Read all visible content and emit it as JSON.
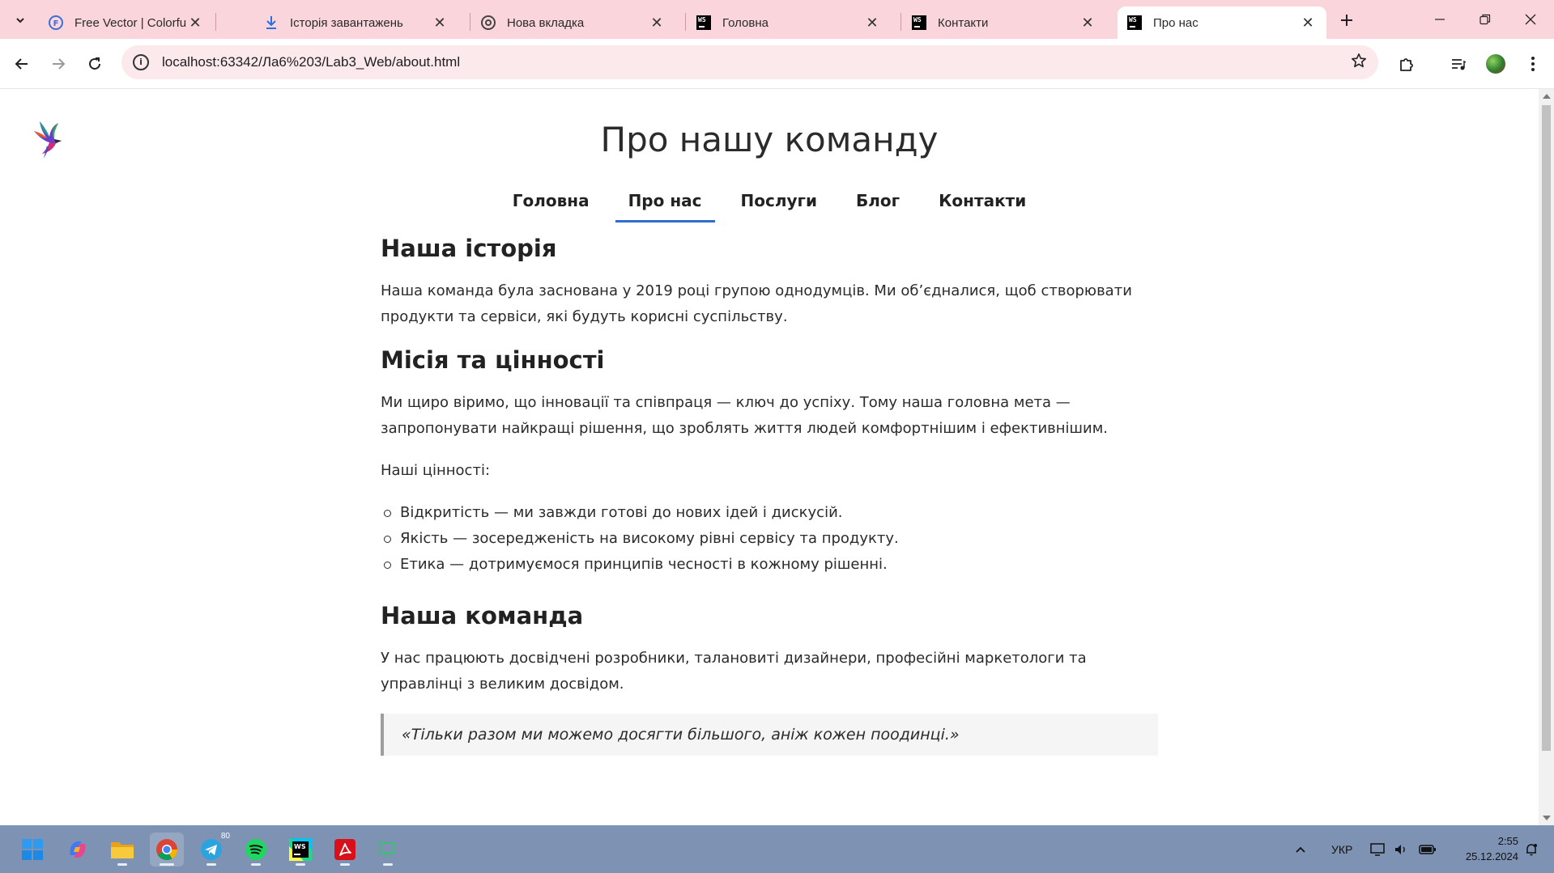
{
  "browser": {
    "tabs": [
      {
        "title": "Free Vector | Colorful bird il",
        "favicon": "freepik-icon",
        "active": false
      },
      {
        "title": "Історія завантажень",
        "favicon": "download-icon",
        "active": false
      },
      {
        "title": "Нова вкладка",
        "favicon": "chrome-icon",
        "active": false
      },
      {
        "title": "Головна",
        "favicon": "webstorm-icon",
        "active": false
      },
      {
        "title": "Контакти",
        "favicon": "webstorm-icon",
        "active": false
      },
      {
        "title": "Про нас",
        "favicon": "webstorm-icon",
        "active": true
      }
    ],
    "url": "localhost:63342/Ла6%203/Lab3_Web/about.html",
    "accent_color": "#fad6dc"
  },
  "page": {
    "title": "Про нашу команду",
    "nav": [
      {
        "label": "Головна",
        "active": false
      },
      {
        "label": "Про нас",
        "active": true
      },
      {
        "label": "Послуги",
        "active": false
      },
      {
        "label": "Блог",
        "active": false
      },
      {
        "label": "Контакти",
        "active": false
      }
    ],
    "sections": {
      "history": {
        "heading": "Наша історія",
        "text": "Наша команда була заснована у 2019 році групою однодумців. Ми об’єдналися, щоб створювати продукти та сервіси, які будуть корисні суспільству."
      },
      "mission": {
        "heading": "Місія та цінності",
        "text": "Ми щиро віримо, що інновації та співпраця — ключ до успіху. Тому наша головна мета — запропонувати найкращі рішення, що зроблять життя людей комфортнішим і ефективнішим.",
        "values_intro": "Наші цінності:",
        "values": [
          "Відкритість — ми завжди готові до нових ідей і дискусій.",
          "Якість — зосередженість на високому рівні сервісу та продукту.",
          "Етика — дотримуємося принципів чесності в кожному рішенні."
        ]
      },
      "team": {
        "heading": "Наша команда",
        "text": "У нас працюють досвідчені розробники, талановиті дизайнери, професійні маркетологи та управлінці з великим досвідом.",
        "quote": "«Тільки разом ми можемо досягти більшого, аніж кожен поодинці.»"
      }
    },
    "nav_active_color": "#2f6fcb"
  },
  "taskbar": {
    "apps": [
      "windows-start-icon",
      "copilot-icon",
      "file-explorer-icon",
      "chrome-icon",
      "telegram-icon",
      "spotify-icon",
      "webstorm-icon",
      "acrobat-icon",
      "display-app-icon"
    ],
    "telegram_badge": "80",
    "language": "УКР",
    "time": "2:55",
    "date": "25.12.2024",
    "color": "#7e93b3"
  }
}
